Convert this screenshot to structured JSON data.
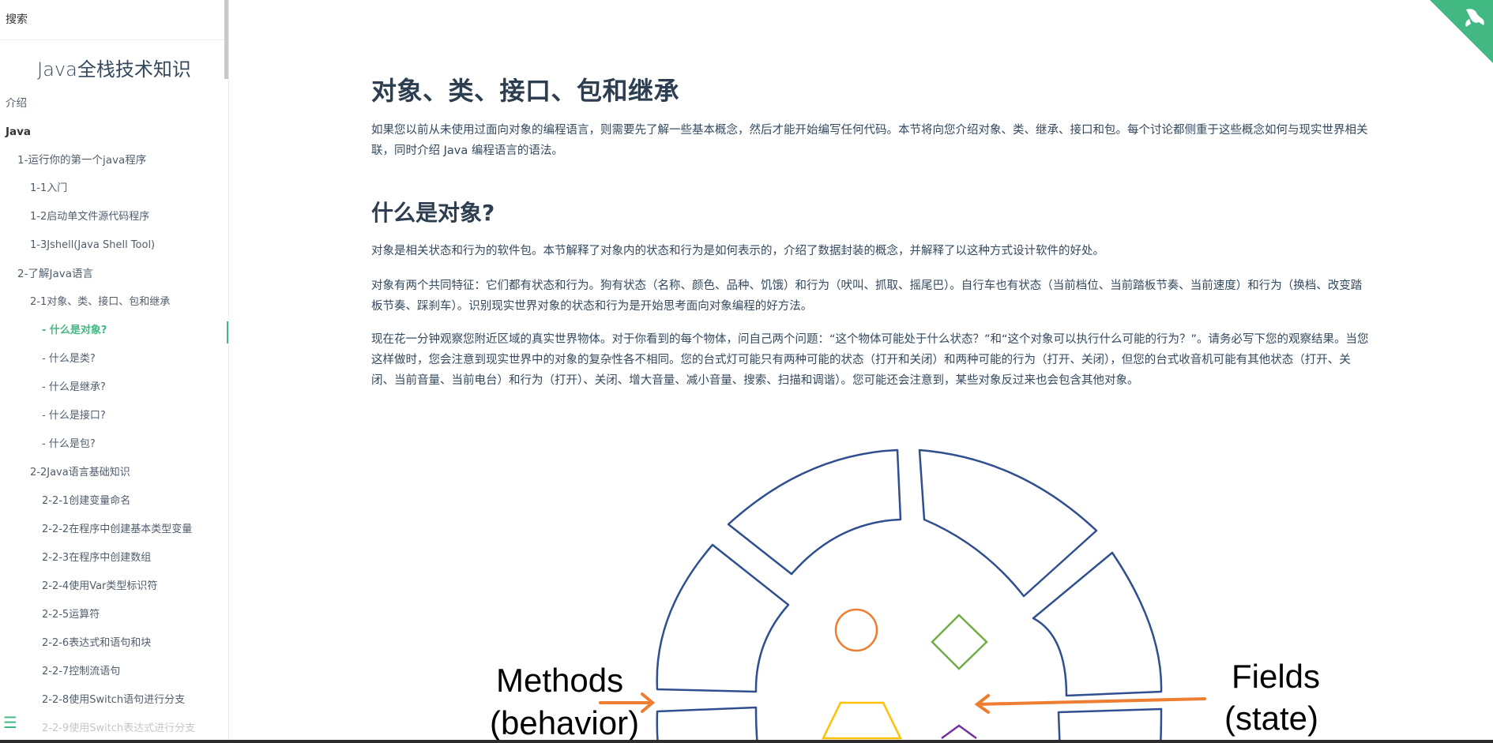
{
  "sidebar": {
    "search_placeholder": "搜索",
    "app_name": "Java全栈技术知识",
    "items": [
      {
        "label": "介绍"
      },
      {
        "label": "Java"
      },
      {
        "label": "1-运行你的第一个java程序"
      },
      {
        "label": "1-1入门"
      },
      {
        "label": "1-2启动单文件源代码程序"
      },
      {
        "label": "1-3Jshell(Java Shell Tool)"
      },
      {
        "label": "2-了解Java语言"
      },
      {
        "label": "2-1对象、类、接口、包和继承"
      },
      {
        "label": "- 什么是对象?"
      },
      {
        "label": "- 什么是类?"
      },
      {
        "label": "- 什么是继承?"
      },
      {
        "label": "- 什么是接口?"
      },
      {
        "label": "- 什么是包?"
      },
      {
        "label": "2-2Java语言基础知识"
      },
      {
        "label": "2-2-1创建变量命名"
      },
      {
        "label": "2-2-2在程序中创建基本类型变量"
      },
      {
        "label": "2-2-3在程序中创建数组"
      },
      {
        "label": "2-2-4使用Var类型标识符"
      },
      {
        "label": "2-2-5运算符"
      },
      {
        "label": "2-2-6表达式和语句和块"
      },
      {
        "label": "2-2-7控制流语句"
      },
      {
        "label": "2-2-8使用Switch语句进行分支"
      },
      {
        "label": "2-2-9使用Switch表达式进行分支"
      }
    ],
    "active_item": "- 什么是对象?",
    "menu_icon": "menu-icon"
  },
  "main": {
    "title": "对象、类、接口、包和继承",
    "intro": "如果您以前从未使用过面向对象的编程语言，则需要先了解一些基本概念，然后才能开始编写任何代码。本节将向您介绍对象、类、继承、接口和包。每个讨论都侧重于这些概念如何与现实世界相关联，同时介绍 Java 编程语言的语法。",
    "section_title": "什么是对象?",
    "paragraphs": [
      "对象是相关状态和行为的软件包。本节解释了对象内的状态和行为是如何表示的，介绍了数据封装的概念，并解释了以这种方式设计软件的好处。",
      "对象有两个共同特征：它们都有状态和行为。狗有状态（名称、颜色、品种、饥饿）和行为（吠叫、抓取、摇尾巴）。自行车也有状态（当前档位、当前踏板节奏、当前速度）和行为（换档、改变踏板节奏、踩刹车）。识别现实世界对象的状态和行为是开始思考面向对象编程的好方法。",
      "现在花一分钟观察您附近区域的真实世界物体。对于你看到的每个物体，问自己两个问题：“这个物体可能处于什么状态？”和“这个对象可以执行什么可能的行为？”。请务必写下您的观察结果。当您这样做时，您会注意到现实世界中的对象的复杂性各不相同。您的台式灯可能只有两种可能的状态（打开和关闭）和两种可能的行为（打开、关闭），但您的台式收音机可能有其他状态（打开、关闭、当前音量、当前电台）和行为（打开）、关闭、增大音量、减小音量、搜索、扫描和调谐）。您可能还会注意到，某些对象反过来也会包含其他对象。"
    ],
    "diagram": {
      "methods_label_1": "Methods",
      "methods_label_2": "(behavior)",
      "fields_label_1": "Fields",
      "fields_label_2": "(state)"
    }
  },
  "colors": {
    "accent": "#42b983",
    "text": "#34495e",
    "heading": "#2c3e50",
    "diagram_stroke": "#2f4f8f",
    "arrow": "#ed7d31",
    "circle": "#ed7d31",
    "diamond": "#70ad47",
    "hexagon": "#ffc000"
  }
}
